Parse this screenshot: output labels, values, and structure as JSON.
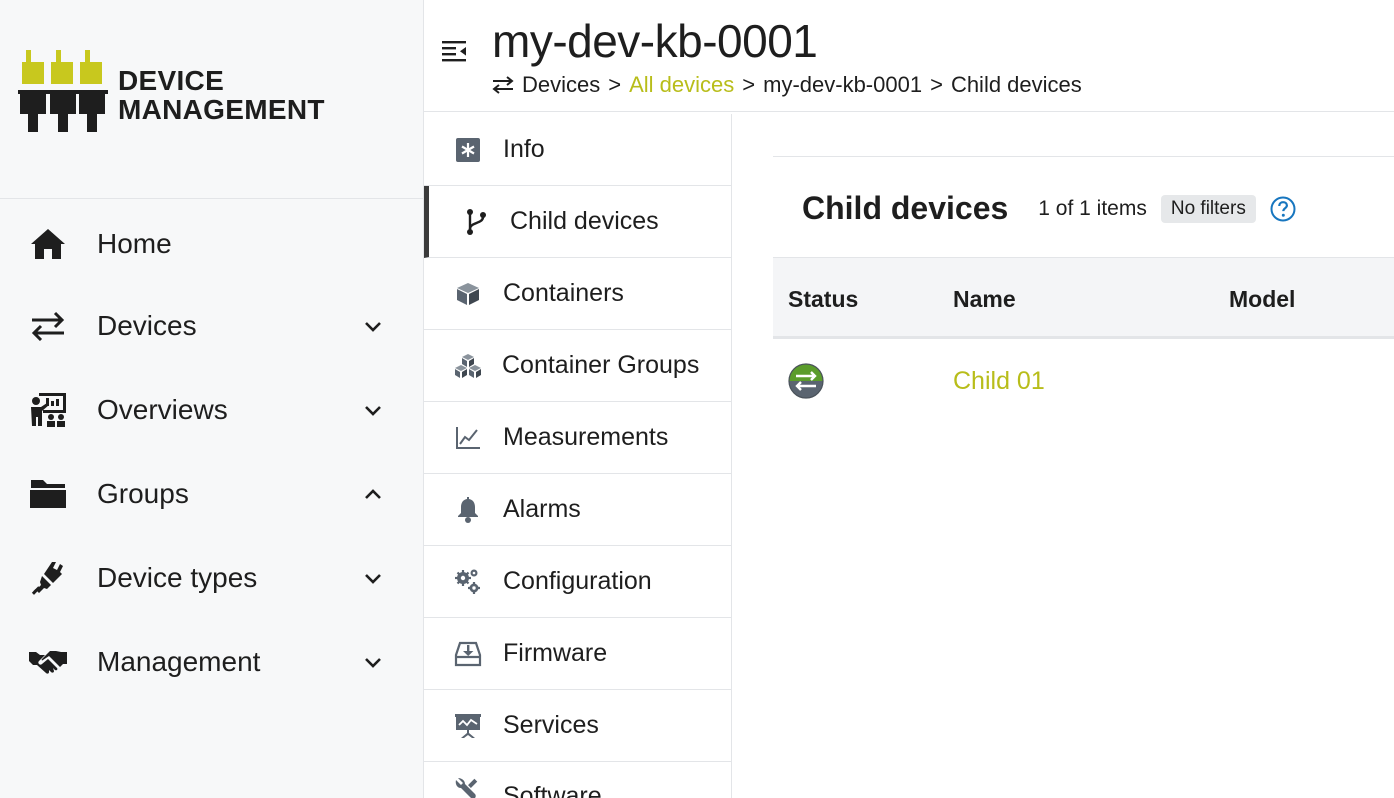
{
  "brand": {
    "line1": "DEVICE",
    "line2": "MANAGEMENT",
    "accent_color": "#c8c81e"
  },
  "sidebar": {
    "items": [
      {
        "label": "Home",
        "icon": "home-icon",
        "expandable": false
      },
      {
        "label": "Devices",
        "icon": "exchange-arrows-icon",
        "expandable": true,
        "expanded": false
      },
      {
        "label": "Overviews",
        "icon": "presentation-icon",
        "expandable": true,
        "expanded": false
      },
      {
        "label": "Groups",
        "icon": "folder-open-icon",
        "expandable": true,
        "expanded": true
      },
      {
        "label": "Device types",
        "icon": "plug-icon",
        "expandable": true,
        "expanded": false
      },
      {
        "label": "Management",
        "icon": "handshake-icon",
        "expandable": true,
        "expanded": false
      }
    ]
  },
  "header": {
    "title": "my-dev-kb-0001",
    "breadcrumb": {
      "root": "Devices",
      "link": "All devices",
      "device": "my-dev-kb-0001",
      "current": "Child devices",
      "separator": ">"
    }
  },
  "tabs": [
    {
      "label": "Info",
      "icon": "asterisk-icon",
      "active": false
    },
    {
      "label": "Child devices",
      "icon": "branch-icon",
      "active": true
    },
    {
      "label": "Containers",
      "icon": "cube-icon",
      "active": false
    },
    {
      "label": "Container Groups",
      "icon": "cubes-icon",
      "active": false
    },
    {
      "label": "Measurements",
      "icon": "line-chart-icon",
      "active": false
    },
    {
      "label": "Alarms",
      "icon": "bell-icon",
      "active": false
    },
    {
      "label": "Configuration",
      "icon": "cogs-icon",
      "active": false
    },
    {
      "label": "Firmware",
      "icon": "download-tray-icon",
      "active": false
    },
    {
      "label": "Services",
      "icon": "services-board-icon",
      "active": false
    },
    {
      "label": "Software",
      "icon": "wrench-icon",
      "active": false
    }
  ],
  "list": {
    "title": "Child devices",
    "count": "1 of 1 items",
    "filter_badge": "No filters",
    "columns": [
      "Status",
      "Name",
      "Model"
    ],
    "rows": [
      {
        "status": "connected",
        "name": "Child 01",
        "model": ""
      }
    ]
  },
  "colors": {
    "link": "#b8bd1a",
    "help": "#1776bf",
    "status_top": "#5b9c2b",
    "status_bottom": "#5a6470",
    "icon_dark": "#1e1e1e",
    "icon_grey": "#5a6470"
  }
}
